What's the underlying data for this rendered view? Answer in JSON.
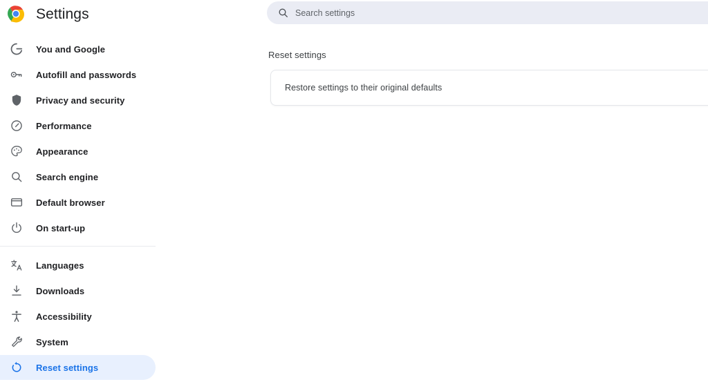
{
  "brand": {
    "logo_icon": "chrome-logo-icon",
    "title": "Settings"
  },
  "search": {
    "icon": "search-icon",
    "value": "",
    "placeholder": "Search settings"
  },
  "sidebar": {
    "groups": [
      {
        "items": [
          {
            "icon": "google-g-icon",
            "label": "You and Google",
            "active": false
          },
          {
            "icon": "key-icon",
            "label": "Autofill and passwords",
            "active": false
          },
          {
            "icon": "shield-icon",
            "label": "Privacy and security",
            "active": false
          },
          {
            "icon": "speedometer-icon",
            "label": "Performance",
            "active": false
          },
          {
            "icon": "palette-icon",
            "label": "Appearance",
            "active": false
          },
          {
            "icon": "magnifier-icon",
            "label": "Search engine",
            "active": false
          },
          {
            "icon": "browser-window-icon",
            "label": "Default browser",
            "active": false
          },
          {
            "icon": "power-icon",
            "label": "On start-up",
            "active": false
          }
        ]
      },
      {
        "items": [
          {
            "icon": "translate-icon",
            "label": "Languages",
            "active": false
          },
          {
            "icon": "download-icon",
            "label": "Downloads",
            "active": false
          },
          {
            "icon": "accessibility-icon",
            "label": "Accessibility",
            "active": false
          },
          {
            "icon": "wrench-icon",
            "label": "System",
            "active": false
          },
          {
            "icon": "reset-icon",
            "label": "Reset settings",
            "active": true
          }
        ]
      }
    ]
  },
  "main": {
    "section_title": "Reset settings",
    "rows": [
      {
        "label": "Restore settings to their original defaults",
        "arrow": "arrow-right-icon"
      }
    ]
  },
  "colors": {
    "accent": "#1a73e8",
    "active_row_bg": "#e8f0fe",
    "search_bg": "#eaecf4",
    "text_primary": "#202124",
    "text_secondary": "#3c4043",
    "icon": "#5f6368",
    "divider": "#e8eaed",
    "card_border": "#e4e6ea"
  }
}
